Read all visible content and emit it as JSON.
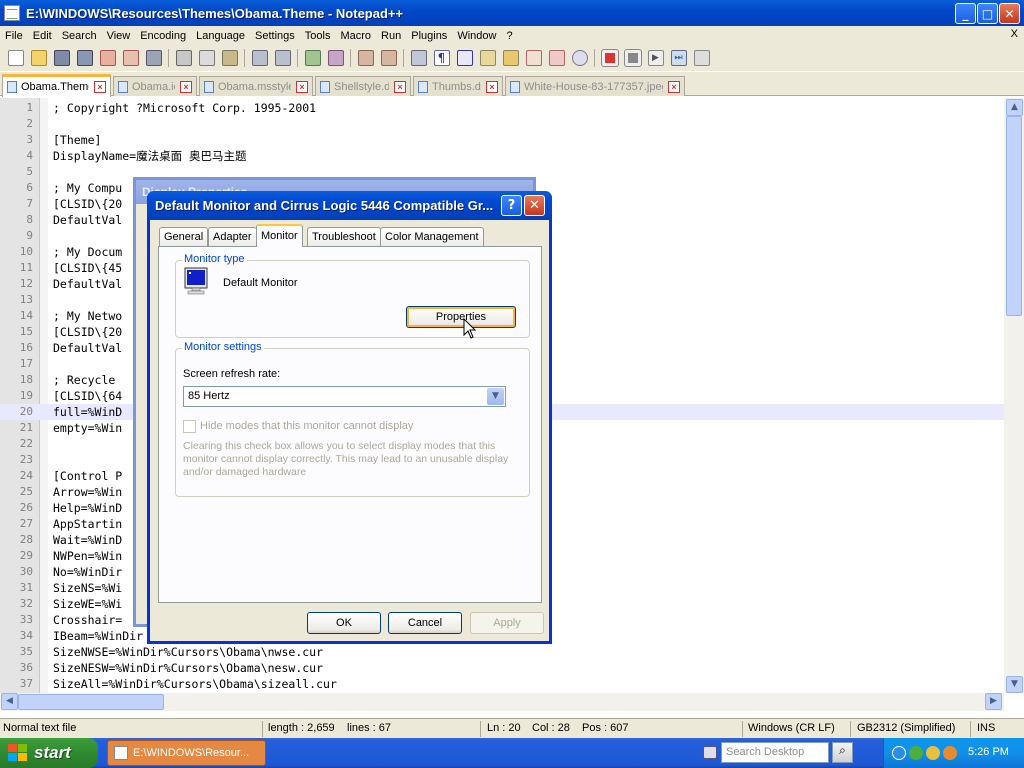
{
  "window": {
    "title": "E:\\WINDOWS\\Resources\\Themes\\Obama.Theme - Notepad++",
    "minimize": "_",
    "maximize": "□",
    "close": "✕"
  },
  "menu": {
    "items": [
      "File",
      "Edit",
      "Search",
      "View",
      "Encoding",
      "Language",
      "Settings",
      "Tools",
      "Macro",
      "Run",
      "Plugins",
      "Window",
      "?"
    ],
    "close_doc": "X"
  },
  "tabs": [
    {
      "label": "Obama.Theme",
      "active": true
    },
    {
      "label": "Obama.icl",
      "active": false
    },
    {
      "label": "Obama.msstyles",
      "active": false
    },
    {
      "label": "Shellstyle.dll",
      "active": false
    },
    {
      "label": "Thumbs.db",
      "active": false
    },
    {
      "label": "White-House-83-177357.jpeg",
      "active": false
    }
  ],
  "editor": {
    "current_line": 20,
    "lines": [
      "; Copyright ?Microsoft Corp. 1995-2001",
      "",
      "[Theme]",
      "DisplayName=魔法桌面 奥巴马主题",
      "",
      "; My Compu",
      "[CLSID\\{20",
      "DefaultVal",
      "",
      "; My Docum",
      "[CLSID\\{45",
      "DefaultVal",
      "",
      "; My Netwo",
      "[CLSID\\{20",
      "DefaultVal",
      "",
      "; Recycle",
      "[CLSID\\{64",
      "full=%WinD",
      "empty=%Win",
      "",
      "",
      "[Control P",
      "Arrow=%Win",
      "Help=%WinD",
      "AppStartin",
      "Wait=%WinD",
      "NWPen=%Win",
      "No=%WinDir",
      "SizeNS=%Wi",
      "SizeWE=%Wi",
      "Crosshair=",
      "IBeam=%WinDir",
      "SizeNWSE=%WinDir%Cursors\\Obama\\nwse.cur",
      "SizeNESW=%WinDir%Cursors\\Obama\\nesw.cur",
      "SizeAll=%WinDir%Cursors\\Obama\\sizeall.cur"
    ]
  },
  "status": {
    "filetype": "Normal text file",
    "length": "length : 2,659",
    "lines": "lines : 67",
    "ln": "Ln : 20",
    "col": "Col : 28",
    "pos": "Pos : 607",
    "eol": "Windows (CR LF)",
    "encoding": "GB2312 (Simplified)",
    "mode": "INS"
  },
  "bg_dialog": {
    "title": "Display Properties"
  },
  "dialog": {
    "title": "Default Monitor and Cirrus Logic 5446 Compatible Gr...",
    "help": "?",
    "close": "✕",
    "tabs": [
      "General",
      "Adapter",
      "Monitor",
      "Troubleshoot",
      "Color Management"
    ],
    "active_tab": "Monitor",
    "monitor_type_label": "Monitor type",
    "monitor_name": "Default Monitor",
    "properties_button": "Properties",
    "monitor_settings_label": "Monitor settings",
    "refresh_label": "Screen refresh rate:",
    "refresh_value": "85 Hertz",
    "hide_modes_label": "Hide modes that this monitor cannot display",
    "hide_modes_checked": false,
    "help_text": "Clearing this check box allows you to select display modes that this monitor cannot display correctly. This may lead to an unusable display and/or damaged hardware",
    "ok": "OK",
    "cancel": "Cancel",
    "apply": "Apply"
  },
  "taskbar": {
    "start": "start",
    "task_label": "E:\\WINDOWS\\Resour...",
    "search_placeholder": "Search Desktop",
    "clock": "5:26 PM"
  },
  "colors": {
    "xp_blue": "#0a5fd8",
    "start_green": "#3c9e3c",
    "current_line": "#e8e8ff",
    "active_tab_accent": "#f9b43c"
  }
}
